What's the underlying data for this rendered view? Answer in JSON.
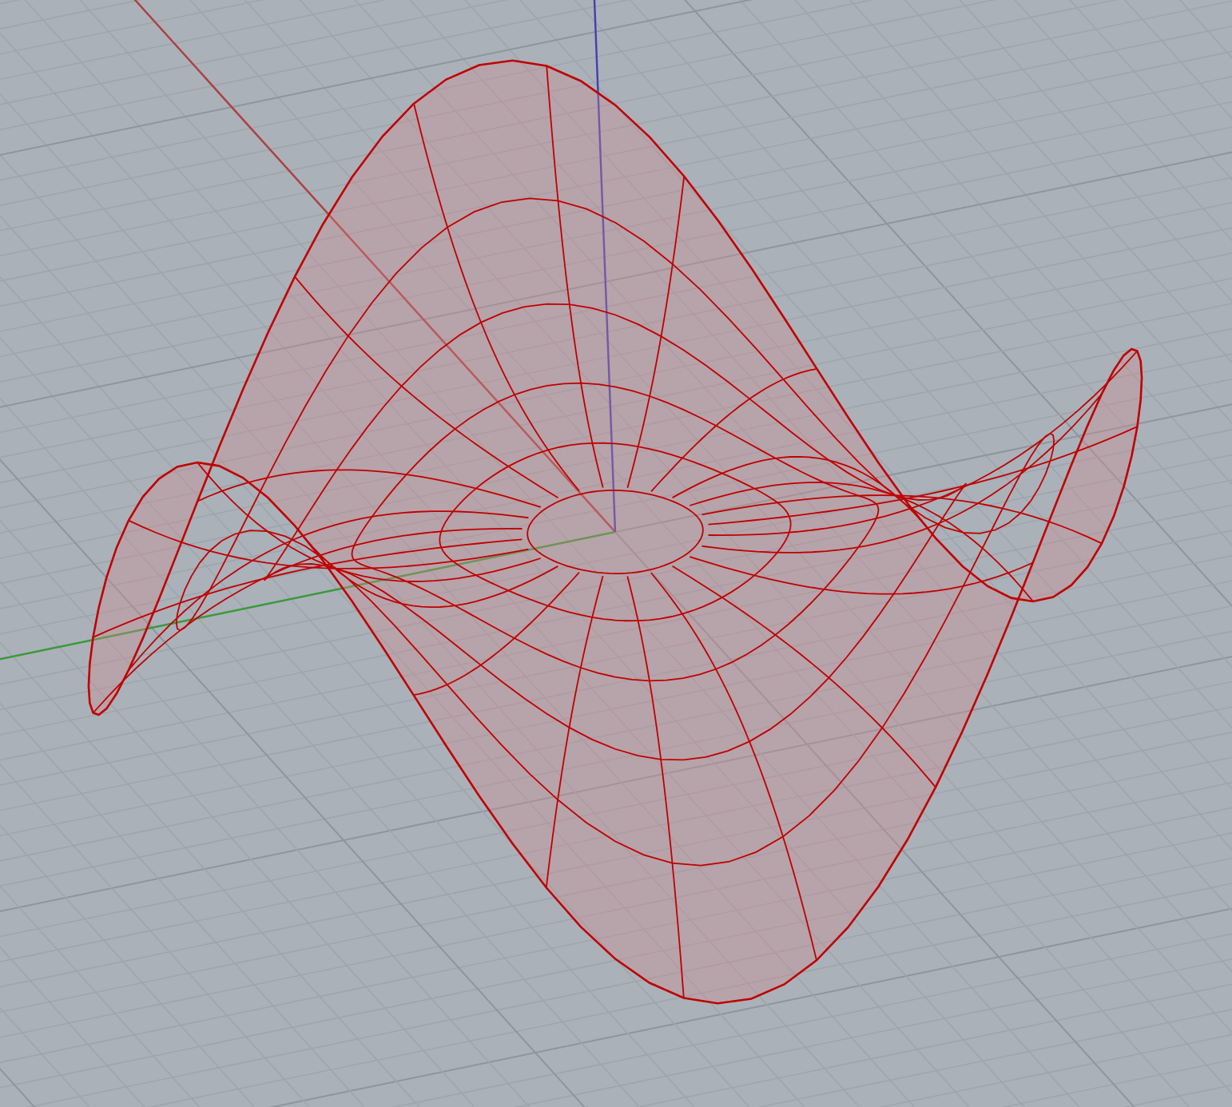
{
  "viewport": {
    "grid": {
      "visible": true
    },
    "axes": {
      "visible": true
    },
    "surface": {
      "kind": "wireframe"
    }
  }
}
